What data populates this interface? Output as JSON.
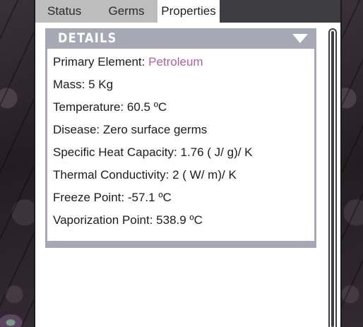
{
  "tabs": [
    {
      "label": "Status",
      "active": false
    },
    {
      "label": "Germs",
      "active": false
    },
    {
      "label": "Properties",
      "active": true
    }
  ],
  "details": {
    "title": "DETAILS",
    "rows": [
      {
        "label": "Primary Element:",
        "value": "Petroleum",
        "value_color": "#b0609a"
      },
      {
        "label": "Mass:",
        "value": "5 Kg"
      },
      {
        "label": "Temperature:",
        "value": "60.5 ºC"
      },
      {
        "label": "Disease:",
        "value": "Zero surface germs"
      },
      {
        "label": "Specific Heat Capacity:",
        "value": "1.76 ( J/ g)/ K"
      },
      {
        "label": "Thermal Conductivity:",
        "value": "2 ( W/ m)/ K"
      },
      {
        "label": "Freeze Point:",
        "value": "-57.1 ºC"
      },
      {
        "label": "Vaporization Point:",
        "value": "538.9 ºC"
      }
    ]
  },
  "colors": {
    "header": "#a6a8b3",
    "tabbar": "#3e3e42",
    "accent": "#b0609a"
  }
}
